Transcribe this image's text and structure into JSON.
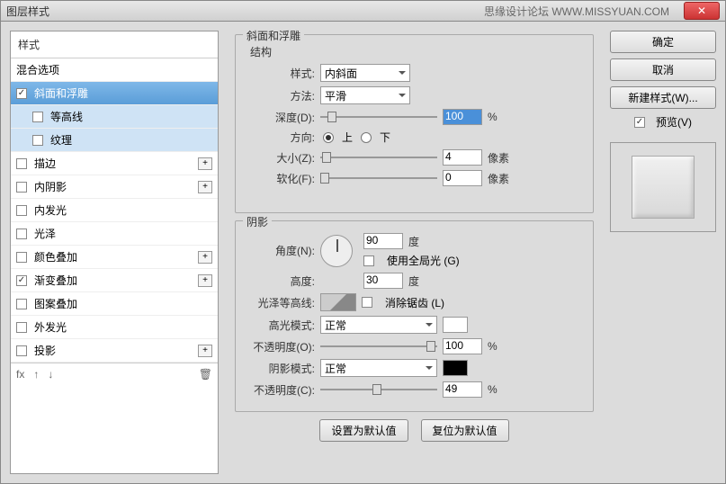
{
  "title": "图层样式",
  "watermark": "思缘设计论坛  WWW.MISSYUAN.COM",
  "sidebar": {
    "header": "样式",
    "blend": "混合选项",
    "items": [
      {
        "label": "斜面和浮雕",
        "checked": true
      },
      {
        "label": "等高线",
        "checked": false
      },
      {
        "label": "纹理",
        "checked": false
      },
      {
        "label": "描边",
        "checked": false,
        "expand": true
      },
      {
        "label": "内阴影",
        "checked": false,
        "expand": true
      },
      {
        "label": "内发光",
        "checked": false
      },
      {
        "label": "光泽",
        "checked": false
      },
      {
        "label": "颜色叠加",
        "checked": false,
        "expand": true
      },
      {
        "label": "渐变叠加",
        "checked": true,
        "expand": true
      },
      {
        "label": "图案叠加",
        "checked": false
      },
      {
        "label": "外发光",
        "checked": false
      },
      {
        "label": "投影",
        "checked": false,
        "expand": true
      }
    ],
    "footer": {
      "fx": "fx",
      "trash": "🗑"
    }
  },
  "structure": {
    "title": "斜面和浮雕",
    "section": "结构",
    "style_label": "样式:",
    "style_value": "内斜面",
    "method_label": "方法:",
    "method_value": "平滑",
    "depth_label": "深度(D):",
    "depth_value": "100",
    "depth_unit": "%",
    "direction_label": "方向:",
    "up": "上",
    "down": "下",
    "size_label": "大小(Z):",
    "size_value": "4",
    "size_unit": "像素",
    "soften_label": "软化(F):",
    "soften_value": "0",
    "soften_unit": "像素"
  },
  "shadow": {
    "section": "阴影",
    "angle_label": "角度(N):",
    "angle_value": "90",
    "angle_unit": "度",
    "global_label": "使用全局光 (G)",
    "altitude_label": "高度:",
    "altitude_value": "30",
    "altitude_unit": "度",
    "gloss_label": "光泽等高线:",
    "anti_label": "消除锯齿 (L)",
    "highlight_mode_label": "高光模式:",
    "highlight_mode_value": "正常",
    "highlight_opacity_label": "不透明度(O):",
    "highlight_opacity_value": "100",
    "pct": "%",
    "shadow_mode_label": "阴影模式:",
    "shadow_mode_value": "正常",
    "shadow_opacity_label": "不透明度(C):",
    "shadow_opacity_value": "49"
  },
  "footer_btns": {
    "default": "设置为默认值",
    "reset": "复位为默认值"
  },
  "right": {
    "ok": "确定",
    "cancel": "取消",
    "newstyle": "新建样式(W)...",
    "preview": "预览(V)"
  }
}
